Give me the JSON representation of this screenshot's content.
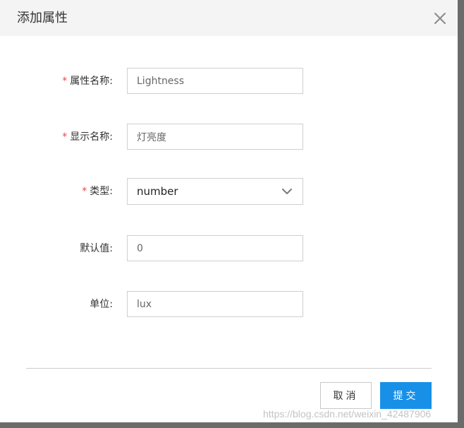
{
  "dialog": {
    "title": "添加属性",
    "close_icon": "close-icon"
  },
  "form": {
    "required_marker": "*",
    "fields": [
      {
        "label": "属性名称:",
        "required": true,
        "type": "text",
        "value": "Lightness"
      },
      {
        "label": "显示名称:",
        "required": true,
        "type": "text",
        "value": "灯亮度"
      },
      {
        "label": "类型:",
        "required": true,
        "type": "select",
        "value": "number",
        "icon": "chevron-down-icon"
      },
      {
        "label": "默认值:",
        "required": false,
        "type": "text",
        "value": "0"
      },
      {
        "label": "单位:",
        "required": false,
        "type": "text",
        "value": "lux"
      }
    ]
  },
  "footer": {
    "cancel_label": "取消",
    "submit_label": "提交"
  },
  "watermark": "https://blog.csdn.net/weixin_42487906",
  "colors": {
    "required": "#e5484d",
    "primary": "#1890e8",
    "header_bg": "#f4f4f4",
    "border": "#cfcfcf"
  }
}
